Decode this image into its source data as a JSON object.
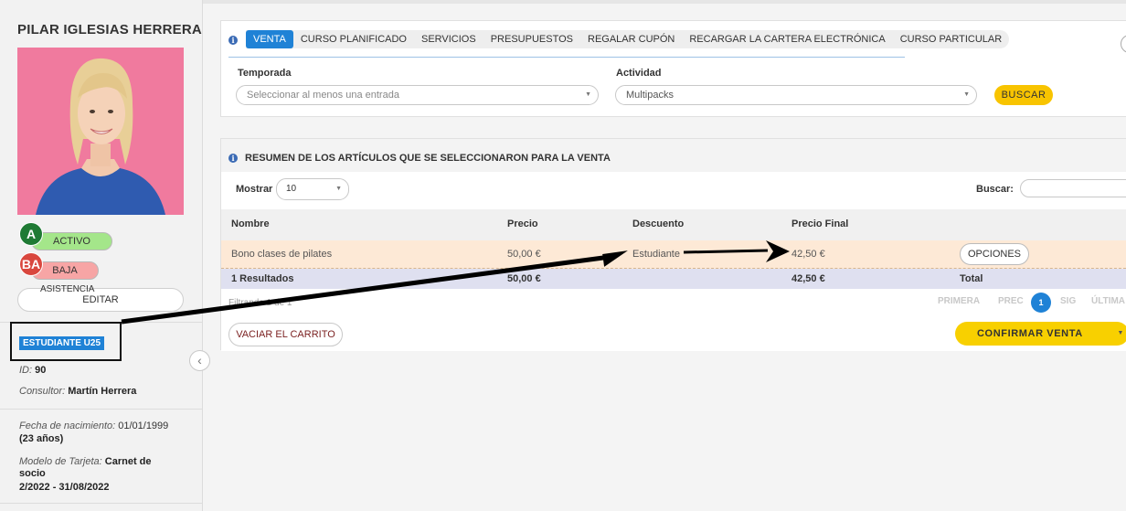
{
  "member": {
    "name": "PILAR IGLESIAS HERRERA",
    "badge_a": "A",
    "badge_ba": "BA",
    "status_activo": "ACTIVO",
    "status_baja": "BAJA",
    "asistencia": "ASISTENCIA",
    "edit_label": "EDITAR",
    "tag": "ESTUDIANTE U25",
    "id_label": "ID:",
    "id_value": "90",
    "consultor_label": "Consultor:",
    "consultor_value": "Martín Herrera",
    "birth_label": "Fecha de nacimiento:",
    "birth_value": "01/01/1999",
    "age": "(23 años)",
    "card_label": "Modelo de Tarjeta:",
    "card_value_1": "Carnet de",
    "card_value_2": "socio",
    "card_dates": "2/2022 - 31/08/2022"
  },
  "tabs": [
    {
      "label": "VENTA",
      "active": true
    },
    {
      "label": "CURSO PLANIFICADO"
    },
    {
      "label": "SERVICIOS"
    },
    {
      "label": "PRESUPUESTOS"
    },
    {
      "label": "REGALAR CUPÓN"
    },
    {
      "label": "RECARGAR LA CARTERA ELECTRÓNICA"
    },
    {
      "label": "CURSO PARTICULAR"
    }
  ],
  "filters": {
    "temporada_label": "Temporada",
    "temporada_placeholder": "Seleccionar al menos una entrada",
    "actividad_label": "Actividad",
    "actividad_value": "Multipacks",
    "buscar_button": "BUSCAR"
  },
  "summary": {
    "title": "RESUMEN DE LOS ARTÍCULOS QUE SE SELECCIONARON PARA LA VENTA",
    "mostrar_label": "Mostrar",
    "mostrar_value": "10",
    "buscar_label": "Buscar:",
    "columns": [
      "Nombre",
      "Precio",
      "Descuento",
      "Precio Final"
    ],
    "row": {
      "nombre": "Bono clases de pilates",
      "precio": "50,00 €",
      "descuento": "Estudiante",
      "precio_final": "42,50 €",
      "options_button": "OPCIONES"
    },
    "footer": {
      "resultados": "1 Resultados",
      "precio": "50,00 €",
      "precio_final": "42,50 €",
      "total": "Total"
    },
    "filter_info": "Filtrando 1 de 1",
    "pager": {
      "first": "PRIMERA",
      "prev": "PREC",
      "current": "1",
      "next": "SIG",
      "last": "ÚLTIMA"
    },
    "vaciar_button": "VACIAR EL CARRITO",
    "confirmar_button": "CONFIRMAR VENTA"
  },
  "icons": {
    "info": "info-icon",
    "collapse": "chevron-left-icon",
    "caret": "caret-down-icon"
  },
  "colors": {
    "accent_blue": "#1f82d6",
    "yellow": "#f8c400",
    "row_highlight": "#fde9d6",
    "active_green": "#a4e68a",
    "baja_red": "#f7a5a5"
  }
}
